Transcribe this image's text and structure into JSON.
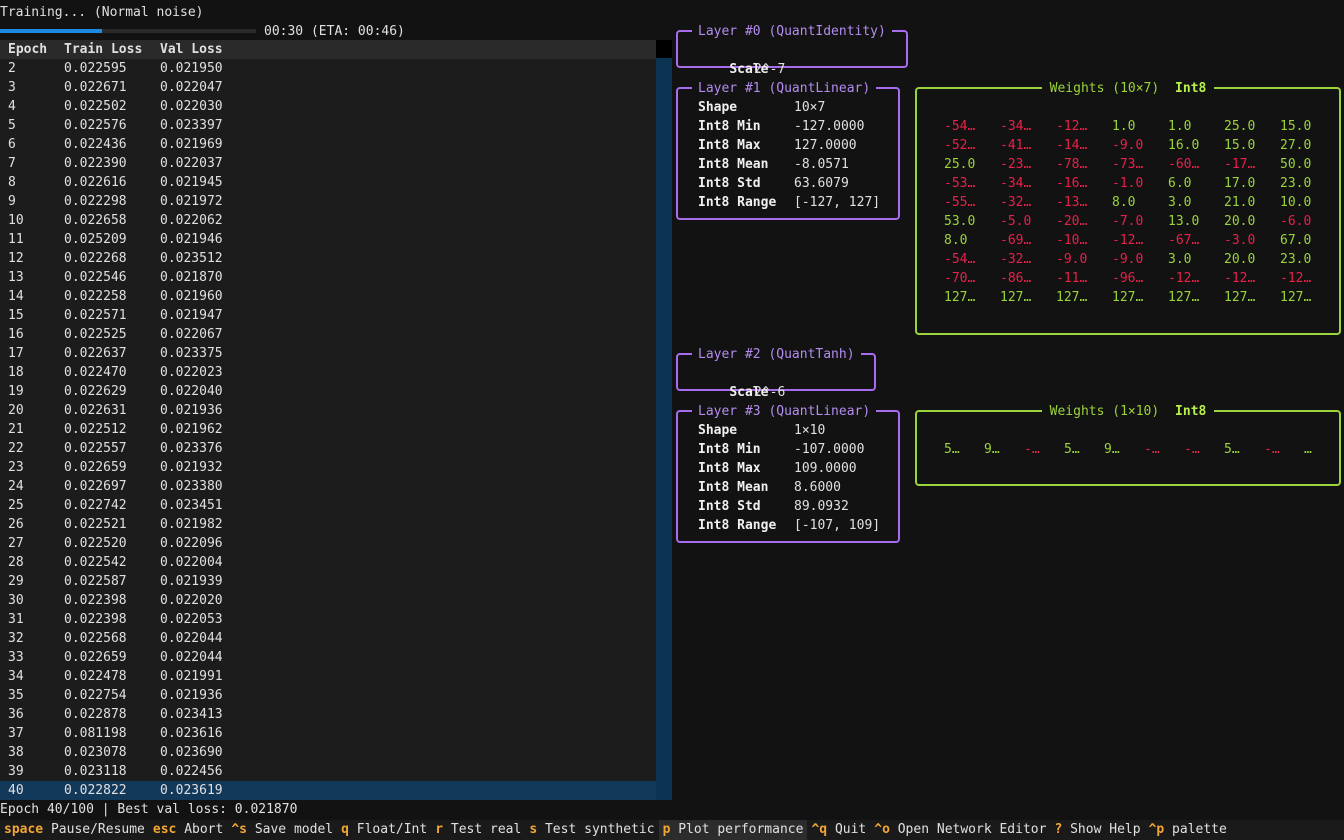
{
  "header": {
    "status": "Training... (Normal noise)",
    "time": "00:30 (ETA: 00:46)",
    "progress_fraction": 0.4
  },
  "table": {
    "columns": [
      "Epoch",
      "Train Loss",
      "Val Loss"
    ],
    "rows": [
      [
        "2",
        "0.022595",
        "0.021950"
      ],
      [
        "3",
        "0.022671",
        "0.022047"
      ],
      [
        "4",
        "0.022502",
        "0.022030"
      ],
      [
        "5",
        "0.022576",
        "0.023397"
      ],
      [
        "6",
        "0.022436",
        "0.021969"
      ],
      [
        "7",
        "0.022390",
        "0.022037"
      ],
      [
        "8",
        "0.022616",
        "0.021945"
      ],
      [
        "9",
        "0.022298",
        "0.021972"
      ],
      [
        "10",
        "0.022658",
        "0.022062"
      ],
      [
        "11",
        "0.025209",
        "0.021946"
      ],
      [
        "12",
        "0.022268",
        "0.023512"
      ],
      [
        "13",
        "0.022546",
        "0.021870"
      ],
      [
        "14",
        "0.022258",
        "0.021960"
      ],
      [
        "15",
        "0.022571",
        "0.021947"
      ],
      [
        "16",
        "0.022525",
        "0.022067"
      ],
      [
        "17",
        "0.022637",
        "0.023375"
      ],
      [
        "18",
        "0.022470",
        "0.022023"
      ],
      [
        "19",
        "0.022629",
        "0.022040"
      ],
      [
        "20",
        "0.022631",
        "0.021936"
      ],
      [
        "21",
        "0.022512",
        "0.021962"
      ],
      [
        "22",
        "0.022557",
        "0.023376"
      ],
      [
        "23",
        "0.022659",
        "0.021932"
      ],
      [
        "24",
        "0.022697",
        "0.023380"
      ],
      [
        "25",
        "0.022742",
        "0.023451"
      ],
      [
        "26",
        "0.022521",
        "0.021982"
      ],
      [
        "27",
        "0.022520",
        "0.022096"
      ],
      [
        "28",
        "0.022542",
        "0.022004"
      ],
      [
        "29",
        "0.022587",
        "0.021939"
      ],
      [
        "30",
        "0.022398",
        "0.022020"
      ],
      [
        "31",
        "0.022398",
        "0.022053"
      ],
      [
        "32",
        "0.022568",
        "0.022044"
      ],
      [
        "33",
        "0.022659",
        "0.022044"
      ],
      [
        "34",
        "0.022478",
        "0.021991"
      ],
      [
        "35",
        "0.022754",
        "0.021936"
      ],
      [
        "36",
        "0.022878",
        "0.023413"
      ],
      [
        "37",
        "0.081198",
        "0.023616"
      ],
      [
        "38",
        "0.023078",
        "0.023690"
      ],
      [
        "39",
        "0.023118",
        "0.022456"
      ],
      [
        "40",
        "0.022822",
        "0.023619"
      ]
    ],
    "selected_epoch": "40"
  },
  "layers": {
    "l0": {
      "title": "Layer #0 (QuantIdentity)",
      "scale_label": "Scale",
      "scale": "2^-7"
    },
    "l1": {
      "title": "Layer #1 (QuantLinear)",
      "stats": [
        [
          "Shape",
          "10×7"
        ],
        [
          "Int8 Min",
          "-127.0000"
        ],
        [
          "Int8 Max",
          "127.0000"
        ],
        [
          "Int8 Mean",
          "-8.0571"
        ],
        [
          "Int8 Std",
          "63.6079"
        ],
        [
          "Int8 Range",
          "[-127, 127]"
        ]
      ],
      "weights_title": "Weights (10×7)",
      "weights_tag": "Int8",
      "weights": [
        [
          "-54…",
          "-34…",
          "-12…",
          "1.0",
          "1.0",
          "25.0",
          "15.0"
        ],
        [
          "-52…",
          "-41…",
          "-14…",
          "-9.0",
          "16.0",
          "15.0",
          "27.0"
        ],
        [
          "25.0",
          "-23…",
          "-78…",
          "-73…",
          "-60…",
          "-17…",
          "50.0"
        ],
        [
          "-53…",
          "-34…",
          "-16…",
          "-1.0",
          "6.0",
          "17.0",
          "23.0"
        ],
        [
          "-55…",
          "-32…",
          "-13…",
          "8.0",
          "3.0",
          "21.0",
          "10.0"
        ],
        [
          "53.0",
          "-5.0",
          "-20…",
          "-7.0",
          "13.0",
          "20.0",
          "-6.0"
        ],
        [
          "8.0",
          "-69…",
          "-10…",
          "-12…",
          "-67…",
          "-3.0",
          "67.0"
        ],
        [
          "-54…",
          "-32…",
          "-9.0",
          "-9.0",
          "3.0",
          "20.0",
          "23.0"
        ],
        [
          "-70…",
          "-86…",
          "-11…",
          "-96…",
          "-12…",
          "-12…",
          "-12…"
        ],
        [
          "127…",
          "127…",
          "127…",
          "127…",
          "127…",
          "127…",
          "127…"
        ]
      ]
    },
    "l2": {
      "title": "Layer #2 (QuantTanh)",
      "scale_label": "Scale",
      "scale": "2^-6"
    },
    "l3": {
      "title": "Layer #3 (QuantLinear)",
      "stats": [
        [
          "Shape",
          "1×10"
        ],
        [
          "Int8 Min",
          "-107.0000"
        ],
        [
          "Int8 Max",
          "109.0000"
        ],
        [
          "Int8 Mean",
          "8.6000"
        ],
        [
          "Int8 Std",
          "89.0932"
        ],
        [
          "Int8 Range",
          "[-107, 109]"
        ]
      ],
      "weights_title": "Weights (1×10)",
      "weights_tag": "Int8",
      "weights": [
        [
          "5…",
          "9…",
          "-…",
          "5…",
          "9…",
          "-…",
          "-…",
          "5…",
          "-…",
          "…"
        ]
      ]
    }
  },
  "footer": {
    "status": "Epoch 40/100 | Best val loss: 0.021870",
    "keys": [
      {
        "key": "space",
        "label": "Pause/Resume"
      },
      {
        "key": "esc",
        "label": "Abort"
      },
      {
        "key": "^s",
        "label": "Save model"
      },
      {
        "key": "q",
        "label": "Float/Int"
      },
      {
        "key": "r",
        "label": "Test real"
      },
      {
        "key": "s",
        "label": "Test synthetic"
      },
      {
        "key": "p",
        "label": "Plot performance",
        "active": true
      },
      {
        "key": "^q",
        "label": "Quit"
      },
      {
        "key": "^o",
        "label": "Open Network Editor"
      },
      {
        "key": "?",
        "label": "Show Help"
      },
      {
        "key": "^p",
        "label": "palette"
      }
    ]
  }
}
